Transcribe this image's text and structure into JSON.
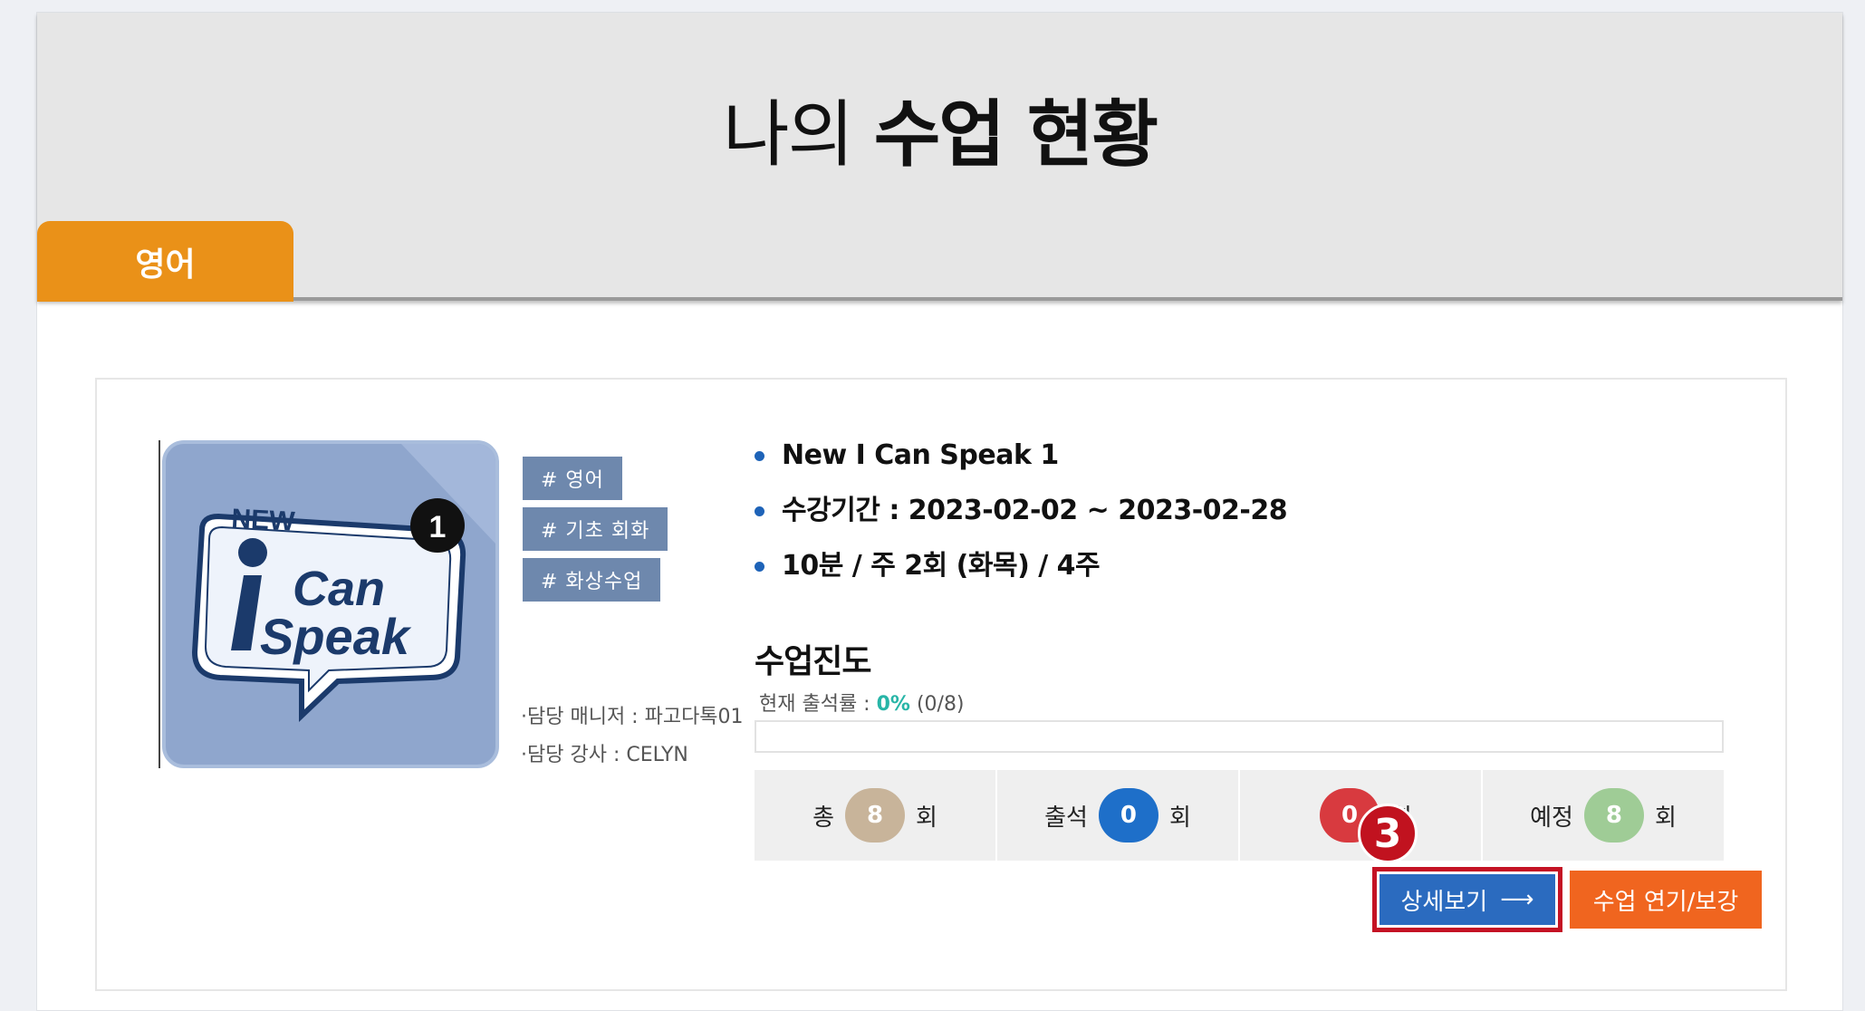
{
  "header": {
    "title_light": "나의",
    "title_bold": "수업 현황"
  },
  "tab": {
    "label": "영어"
  },
  "course": {
    "thumbnail": {
      "badge_number": "1",
      "logo_new": "NEW",
      "logo_i": "i",
      "logo_can": "Can",
      "logo_speak": "Speak"
    },
    "tags": [
      "# 영어",
      "# 기초 회화",
      "# 화상수업"
    ],
    "manager": "·담당 매니저 : 파고다톡01",
    "teacher": "·담당 강사 : CELYN",
    "info": [
      "New I Can Speak 1",
      "수강기간 : 2023-02-02 ~ 2023-02-28",
      "10분 / 주 2회 (화목) / 4주"
    ]
  },
  "progress": {
    "title": "수업진도",
    "rate_label": "현재 출석률 : ",
    "rate_percent": "0%",
    "rate_count": " (0/8)",
    "fill_fraction": 0,
    "unit": "회",
    "stats": [
      {
        "label": "총",
        "value": "8",
        "color": "#c8b49a"
      },
      {
        "label": "출석",
        "value": "0",
        "color": "#1e6fc9"
      },
      {
        "label": "",
        "value": "0",
        "color": "#d83a3f"
      },
      {
        "label": "예정",
        "value": "8",
        "color": "#9fcc96"
      }
    ]
  },
  "annotation_marker": "3",
  "buttons": {
    "detail": "상세보기",
    "detail_arrow": "⟶",
    "extend": "수업 연기/보강"
  },
  "colors": {
    "tab": "#ea9118",
    "tag": "#6e88ad",
    "bullet": "#1e63b8",
    "accent_teal": "#27b5a7",
    "detail_button": "#2b6bbf",
    "extend_button": "#f0651f",
    "highlight": "#c41224"
  }
}
